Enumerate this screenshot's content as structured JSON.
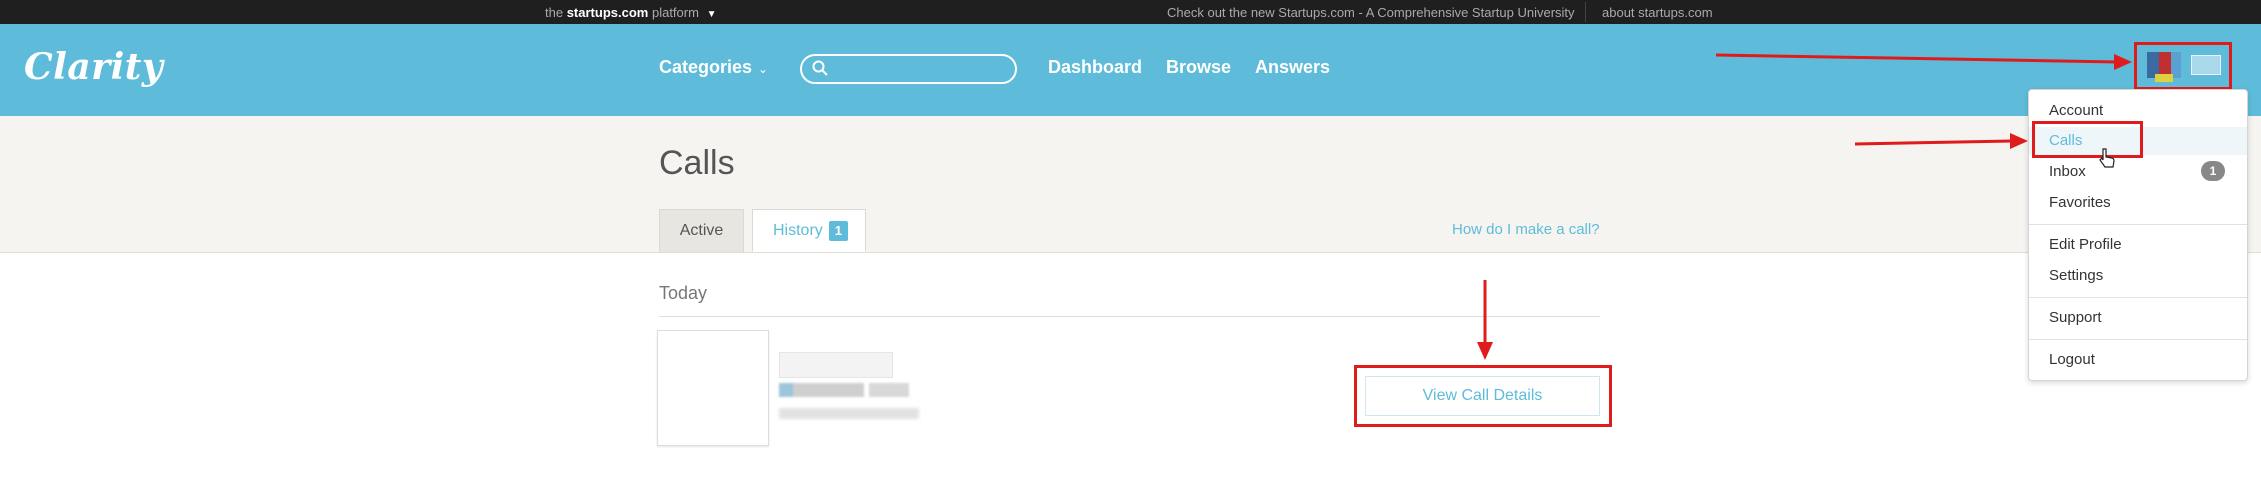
{
  "platform_bar": {
    "prefix": "the",
    "brand": "startups.com",
    "suffix": "platform",
    "promo": "Check out the new Startups.com - A Comprehensive Startup University",
    "about": "about startups.com"
  },
  "header": {
    "logo": "Clarity",
    "categories": "Categories",
    "search_placeholder": "",
    "nav": {
      "dashboard": "Dashboard",
      "browse": "Browse",
      "answers": "Answers"
    }
  },
  "page": {
    "title": "Calls",
    "tabs": {
      "active": "Active",
      "history": "History",
      "history_count": "1"
    },
    "help_link": "How do I make a call?",
    "section": "Today",
    "view_details": "View Call Details"
  },
  "dropdown": {
    "account": "Account",
    "calls": "Calls",
    "inbox": "Inbox",
    "inbox_count": "1",
    "favorites": "Favorites",
    "edit_profile": "Edit Profile",
    "settings": "Settings",
    "support": "Support",
    "logout": "Logout"
  },
  "colors": {
    "header": "#5ebcda",
    "accent": "#5ebcda",
    "annotation": "#e01b1b",
    "platform_bar": "#1f1f1f"
  },
  "icons": [
    "chevron-down-icon",
    "search-icon",
    "cursor-icon",
    "arrow-icon"
  ]
}
